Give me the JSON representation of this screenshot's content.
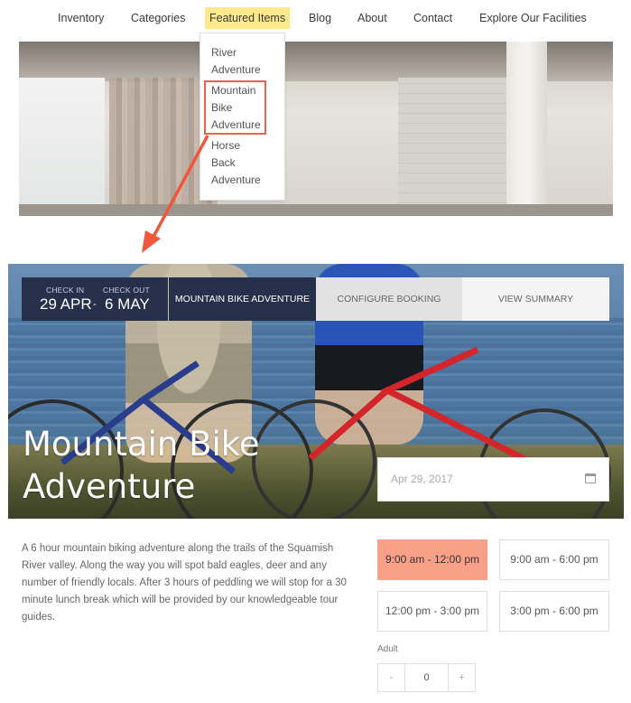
{
  "nav": {
    "items": [
      "Inventory",
      "Categories",
      "Featured Items",
      "Blog",
      "About",
      "Contact",
      "Explore Our Facilities"
    ],
    "active": "Featured Items"
  },
  "dropdown": {
    "items": [
      "River Adventure",
      "Mountain Bike Adventure",
      "Horse Back Adventure"
    ],
    "lines": [
      [
        "River",
        "Adventure"
      ],
      [
        "Mountain",
        "Bike",
        "Adventure"
      ],
      [
        "Horse",
        "Back",
        "Adventure"
      ]
    ]
  },
  "booking": {
    "check_in_label": "CHECK IN",
    "check_in_value": "29 APR",
    "separator": "-",
    "check_out_label": "CHECK OUT",
    "check_out_value": "6 MAY",
    "tabs": [
      "MOUNTAIN BIKE ADVENTURE",
      "CONFIGURE BOOKING",
      "VIEW SUMMARY"
    ]
  },
  "hero": {
    "title_lines": [
      "Mountain Bike",
      "Adventure"
    ],
    "date_value": "Apr 29, 2017"
  },
  "description": "A 6 hour mountain biking adventure along the trails of the Squamish River valley. Along the way you will spot bald eagles, deer and any number of friendly locals. After 3 hours of peddling we will stop for a 30 minute lunch break which will be provided by our knowledgeable tour guides.",
  "time_slots": [
    "9:00 am - 12:00 pm",
    "9:00 am - 6:00 pm",
    "12:00 pm - 3:00 pm",
    "3:00 pm - 6:00 pm"
  ],
  "selected_slot": "9:00 am - 12:00 pm",
  "adult": {
    "label": "Adult",
    "minus": "-",
    "value": "0",
    "plus": "+"
  },
  "colors": {
    "nav_active_bg": "#fde98a",
    "highlight_border": "#e4644f",
    "booking_dark": "#26304a",
    "selected_slot": "#f8a088"
  }
}
